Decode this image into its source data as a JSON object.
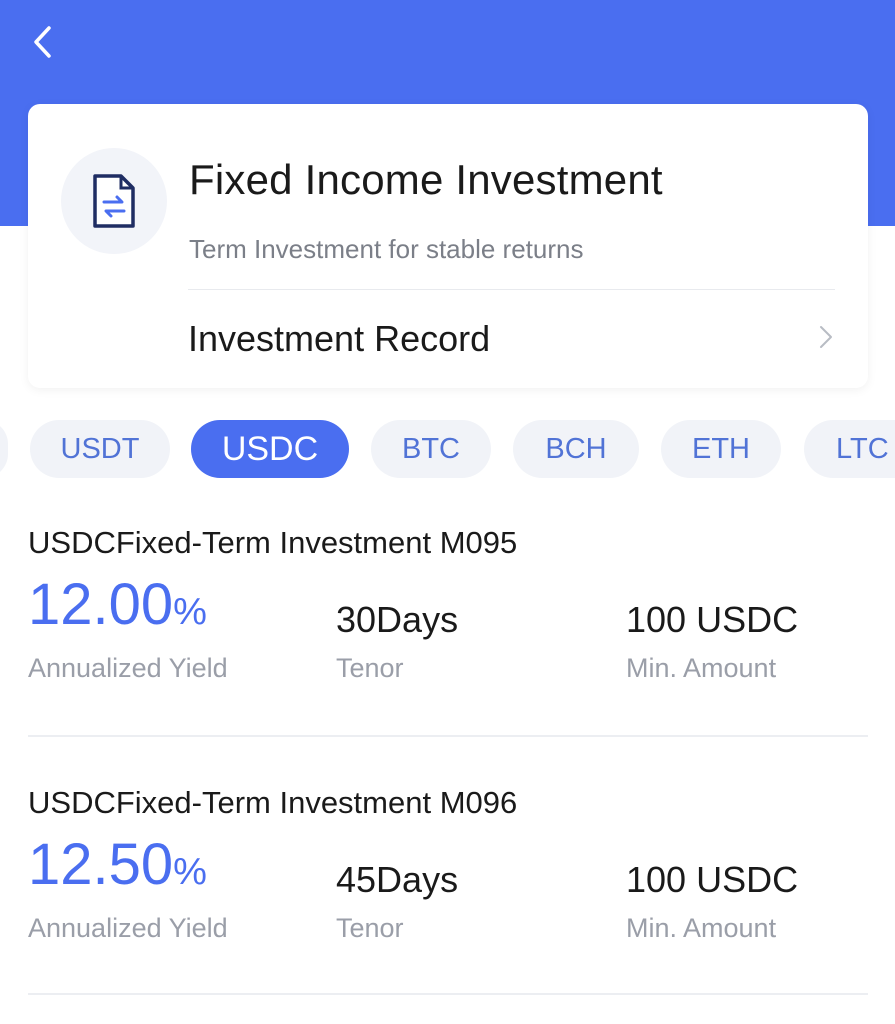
{
  "header": {
    "back_icon": "chevron-left-icon",
    "background_color": "#4a6ef0"
  },
  "card": {
    "icon": "document-exchange-icon",
    "title": "Fixed Income Investment",
    "subtitle": "Term Investment for stable returns",
    "record_label": "Investment Record",
    "record_icon": "chevron-right-icon"
  },
  "tabs": [
    {
      "label": "USDT",
      "active": false
    },
    {
      "label": "USDC",
      "active": true
    },
    {
      "label": "BTC",
      "active": false
    },
    {
      "label": "BCH",
      "active": false
    },
    {
      "label": "ETH",
      "active": false
    },
    {
      "label": "LTC",
      "active": false
    }
  ],
  "products": [
    {
      "name": "USDCFixed-Term Investment M095",
      "yield_value": "12.00",
      "yield_unit": "%",
      "yield_label": "Annualized Yield",
      "tenor_value": "30",
      "tenor_unit": "Days",
      "tenor_label": "Tenor",
      "min_amount": "100 USDC",
      "min_amount_label": "Min. Amount"
    },
    {
      "name": "USDCFixed-Term Investment M096",
      "yield_value": "12.50",
      "yield_unit": "%",
      "yield_label": "Annualized Yield",
      "tenor_value": "45",
      "tenor_unit": "Days",
      "tenor_label": "Tenor",
      "min_amount": "100 USDC",
      "min_amount_label": "Min. Amount"
    }
  ],
  "colors": {
    "accent": "#4a6ef0",
    "tab_bg": "#f1f3f8",
    "label_gray": "#9a9ea8"
  }
}
